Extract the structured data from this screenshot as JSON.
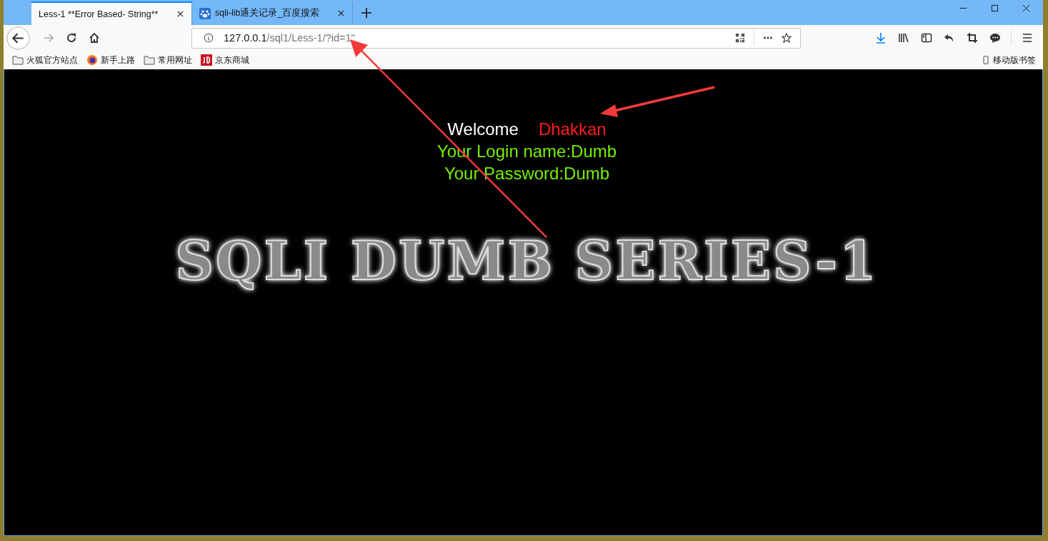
{
  "tabs": [
    {
      "label": "Less-1 **Error Based- String**",
      "selected": true
    },
    {
      "label": "sqli-lib通关记录_百度搜索",
      "selected": false
    }
  ],
  "address_bar": {
    "host": "127.0.0.1",
    "path": "/sql1/Less-1/?id=1''"
  },
  "bookmarks": [
    {
      "label": "火狐官方站点",
      "kind": "folder"
    },
    {
      "label": "新手上路",
      "kind": "firefox"
    },
    {
      "label": "常用网址",
      "kind": "folder"
    },
    {
      "label": "京东商城",
      "kind": "jd"
    }
  ],
  "mobile_bookmarks": "移动版书签",
  "page": {
    "welcome": "Welcome",
    "user": "Dhakkan",
    "login_name": "Your Login name:Dumb",
    "password": "Your Password:Dumb",
    "title": "SQLI DUMB SERIES-1"
  }
}
